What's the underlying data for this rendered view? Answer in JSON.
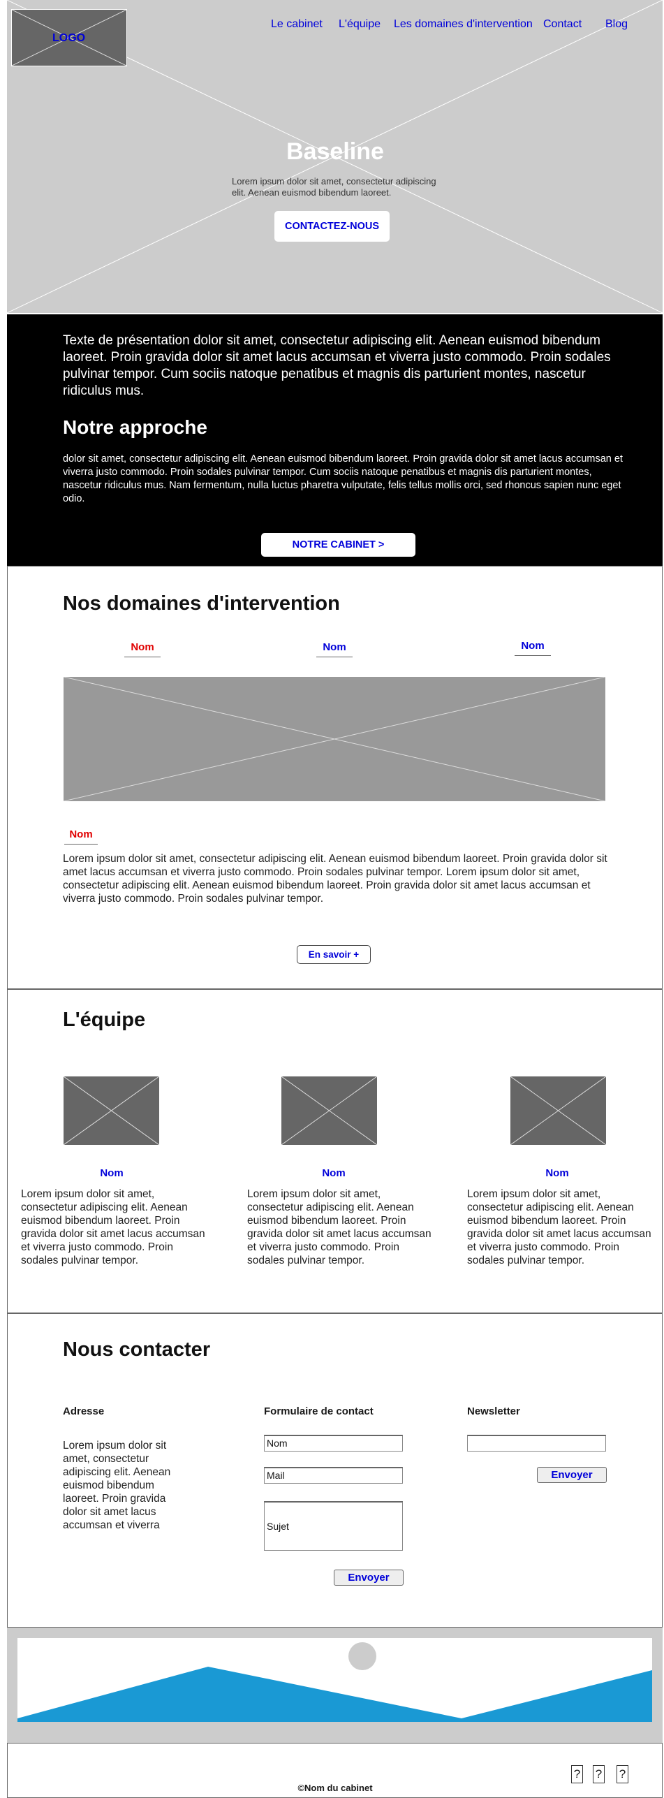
{
  "header": {
    "logo": "LOGO",
    "nav": [
      "Le cabinet",
      "L'équipe",
      "Les domaines d'intervention",
      "Contact",
      "Blog"
    ],
    "title": "Baseline",
    "subtitle": "Lorem ipsum dolor sit amet, consectetur adipiscing elit. Aenean euismod bibendum laoreet.",
    "cta": "CONTACTEZ-NOUS"
  },
  "presentation": {
    "intro": "Texte de présentation dolor sit amet, consectetur adipiscing elit. Aenean euismod bibendum laoreet. Proin gravida dolor sit amet lacus accumsan et viverra justo commodo. Proin sodales pulvinar tempor. Cum sociis natoque penatibus et magnis dis parturient montes, nascetur ridiculus mus.",
    "heading": "Notre approche",
    "text": "dolor sit amet, consectetur adipiscing elit. Aenean euismod bibendum laoreet. Proin gravida dolor sit amet lacus accumsan et viverra justo commodo. Proin sodales pulvinar tempor. Cum sociis natoque penatibus et magnis dis parturient montes, nascetur ridiculus mus. Nam fermentum, nulla luctus pharetra vulputate, felis tellus mollis orci, sed rhoncus sapien nunc eget odio.",
    "button": "NOTRE CABINET >"
  },
  "domains": {
    "heading": "Nos domaines d'intervention",
    "tabs": [
      "Nom",
      "Nom",
      "Nom"
    ],
    "active_name": "Nom",
    "text": "Lorem ipsum dolor sit amet, consectetur adipiscing elit. Aenean euismod bibendum laoreet. Proin gravida dolor sit amet lacus accumsan et viverra justo commodo. Proin sodales pulvinar tempor. Lorem ipsum dolor sit amet, consectetur adipiscing elit. Aenean euismod bibendum laoreet. Proin gravida dolor sit amet lacus accumsan et viverra justo commodo. Proin sodales pulvinar tempor.",
    "button": "En savoir +"
  },
  "team": {
    "heading": "L'équipe",
    "members": [
      {
        "name": "Nom",
        "text": "Lorem ipsum dolor sit amet, consectetur adipiscing elit. Aenean euismod bibendum laoreet. Proin gravida dolor sit amet lacus accumsan et viverra justo commodo. Proin sodales pulvinar tempor."
      },
      {
        "name": "Nom",
        "text": "Lorem ipsum dolor sit amet, consectetur adipiscing elit. Aenean euismod bibendum laoreet. Proin gravida dolor sit amet lacus accumsan et viverra justo commodo. Proin sodales pulvinar tempor."
      },
      {
        "name": "Nom",
        "text": "Lorem ipsum dolor sit amet, consectetur adipiscing elit. Aenean euismod bibendum laoreet. Proin gravida dolor sit amet lacus accumsan et viverra justo commodo. Proin sodales pulvinar tempor."
      }
    ]
  },
  "contact": {
    "heading": "Nous contacter",
    "address_label": "Adresse",
    "address_text": "Lorem ipsum dolor sit amet, consectetur adipiscing elit. Aenean euismod bibendum laoreet. Proin gravida dolor sit amet lacus accumsan et viverra",
    "form_label": "Formulaire de contact",
    "name_value": "Nom",
    "mail_value": "Mail",
    "subject_value": "Sujet",
    "send_label": "Envoyer",
    "newsletter_label": "Newsletter",
    "newsletter_value": "",
    "newsletter_send_label": "Envoyer"
  },
  "footer": {
    "copyright": "©Nom du cabinet",
    "social_icons": [
      "?",
      "?",
      "?"
    ]
  },
  "colors": {
    "link": "#0000d9",
    "active_tab": "#e00000",
    "placeholder": "#cccccc",
    "dark_section": "#000000",
    "map_blue": "#1a99d4"
  }
}
